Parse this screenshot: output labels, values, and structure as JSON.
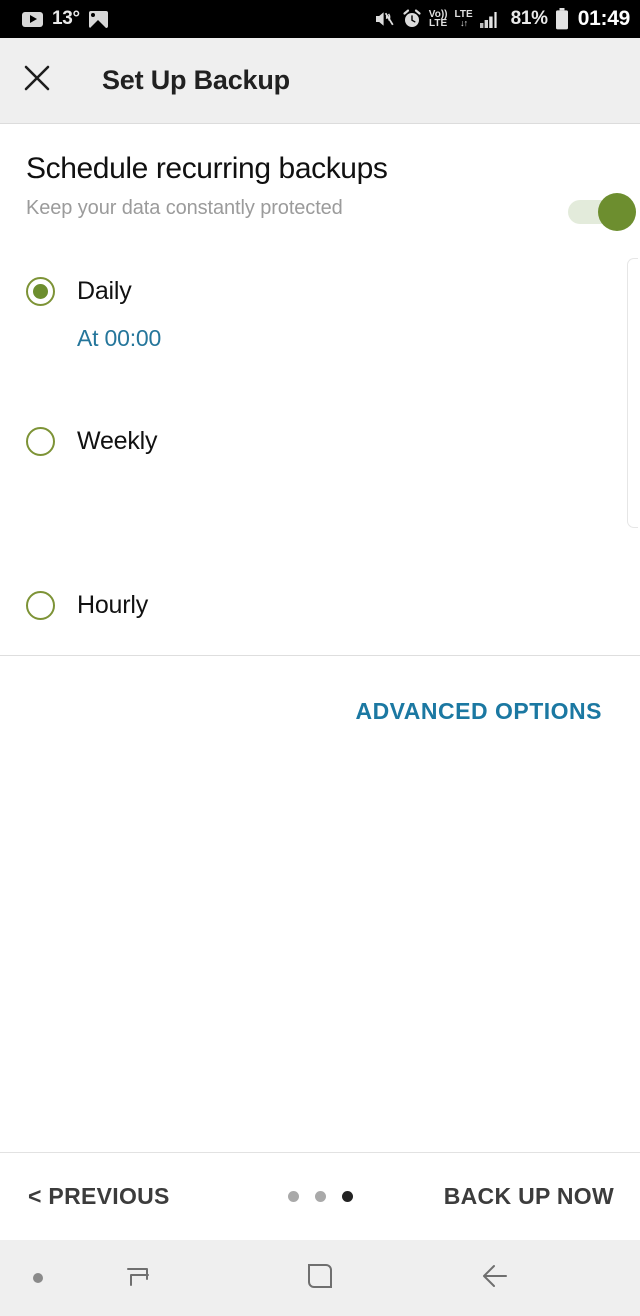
{
  "statusbar": {
    "left_icons": [
      "youtube-play-icon",
      "photo-icon"
    ],
    "temperature": "13°",
    "right_icons": [
      "mute-vibrate-icon",
      "alarm-icon",
      "volte-icon",
      "lte-data-icon",
      "signal-bars-icon",
      "battery-icon"
    ],
    "volte_line1": "Vo))",
    "volte_line2": "LTE",
    "lte_line1": "LTE",
    "lte_line2": "↓↑",
    "battery_percent": "81%",
    "time": "01:49"
  },
  "appbar": {
    "close_icon": "close-icon",
    "title": "Set Up Backup",
    "background": "#efefef"
  },
  "main": {
    "section_title": "Schedule recurring backups",
    "section_subtitle": "Keep your data constantly protected",
    "toggle": {
      "name": "schedule-recurring-backups-toggle",
      "state": "on",
      "on_color": "#6d8e2f",
      "track_color": "#e3ebdb"
    },
    "options": [
      {
        "label": "Daily",
        "selected": true,
        "sub_value": "At 00:00"
      },
      {
        "label": "Weekly",
        "selected": false,
        "sub_value": ""
      },
      {
        "label": "Hourly",
        "selected": false,
        "sub_value": ""
      }
    ],
    "radio_color": "#7d9336",
    "sub_value_color": "#25769b",
    "advanced_options_label": "ADVANCED OPTIONS",
    "advanced_options_color": "#1b78a2"
  },
  "bottombar": {
    "previous_label": "< PREVIOUS",
    "next_label": "BACK UP NOW",
    "dots_total": 3,
    "dots_active_index": 2
  },
  "navbar": {
    "keyboard_dot": "keyboard-indicator-dot",
    "recents_icon": "recents-icon",
    "home_icon": "home-icon",
    "back_icon": "back-arrow-icon"
  }
}
